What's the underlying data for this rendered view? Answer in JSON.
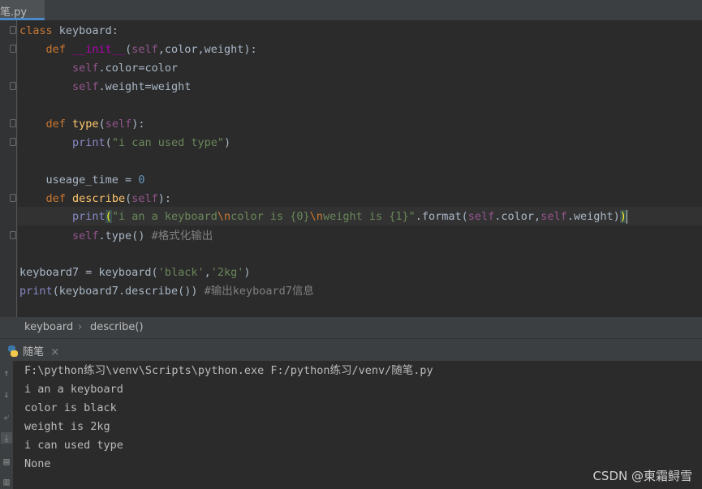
{
  "tab": {
    "file": "笔.py"
  },
  "code": {
    "l1_kw": "class",
    "l1_name": "keyboard:",
    "l2_kw": "def",
    "l2_fn": "__init__",
    "l2_open": "(",
    "l2_self": "self",
    "l2_rest": ",color,weight):",
    "l3_self": "self",
    "l3_rest": ".color=color",
    "l4_self": "self",
    "l4_rest": ".weight=weight",
    "l6_kw": "def",
    "l6_fn": "type",
    "l6_open": "(",
    "l6_self": "self",
    "l6_close": "):",
    "l7_print": "print",
    "l7_open": "(",
    "l7_str": "\"i can used type\"",
    "l7_close": ")",
    "l9_name": "useage_time = ",
    "l9_num": "0",
    "l10_kw": "def",
    "l10_fn": "describe",
    "l10_open": "(",
    "l10_self": "self",
    "l10_close": "):",
    "l11_print": "print",
    "l11_open": "(",
    "l11_s1": "\"i an a keyboard",
    "l11_e1": "\\n",
    "l11_s2": "color is {0}",
    "l11_e2": "\\n",
    "l11_s3": "weight is {1}\"",
    "l11_fmt": ".format(",
    "l11_self1": "self",
    "l11_c1": ".color,",
    "l11_self2": "self",
    "l11_c2": ".weight)",
    "l11_close": ")",
    "l12_self": "self",
    "l12_rest": ".type() ",
    "l12_cmt": "#格式化输出",
    "l14_name": "keyboard7 = keyboard(",
    "l14_s1": "'black'",
    "l14_comma": ",",
    "l14_s2": "'2kg'",
    "l14_close": ")",
    "l15_print": "print",
    "l15_rest": "(keyboard7.describe()) ",
    "l15_cmt": "#输出keyboard7信息"
  },
  "breadcrumb": {
    "item1": "keyboard",
    "sep": "›",
    "item2": "describe()"
  },
  "run": {
    "tab_label": "随笔",
    "close": "×"
  },
  "console": {
    "lines": [
      "F:\\python练习\\venv\\Scripts\\python.exe F:/python练习/venv/随笔.py",
      "i an a keyboard",
      "color is black",
      "weight is 2kg",
      "i can used type",
      "None"
    ]
  },
  "watermark": "CSDN @東霜鲟雪",
  "colors": {
    "keyword": "#cc7832",
    "string": "#6a8759",
    "self": "#94558d",
    "function": "#ffc66d"
  },
  "icons": [
    "up-arrow-icon",
    "down-arrow-icon",
    "soft-wrap-icon",
    "scroll-to-end-icon",
    "print-icon",
    "trash-icon",
    "python-icon",
    "close-icon"
  ]
}
